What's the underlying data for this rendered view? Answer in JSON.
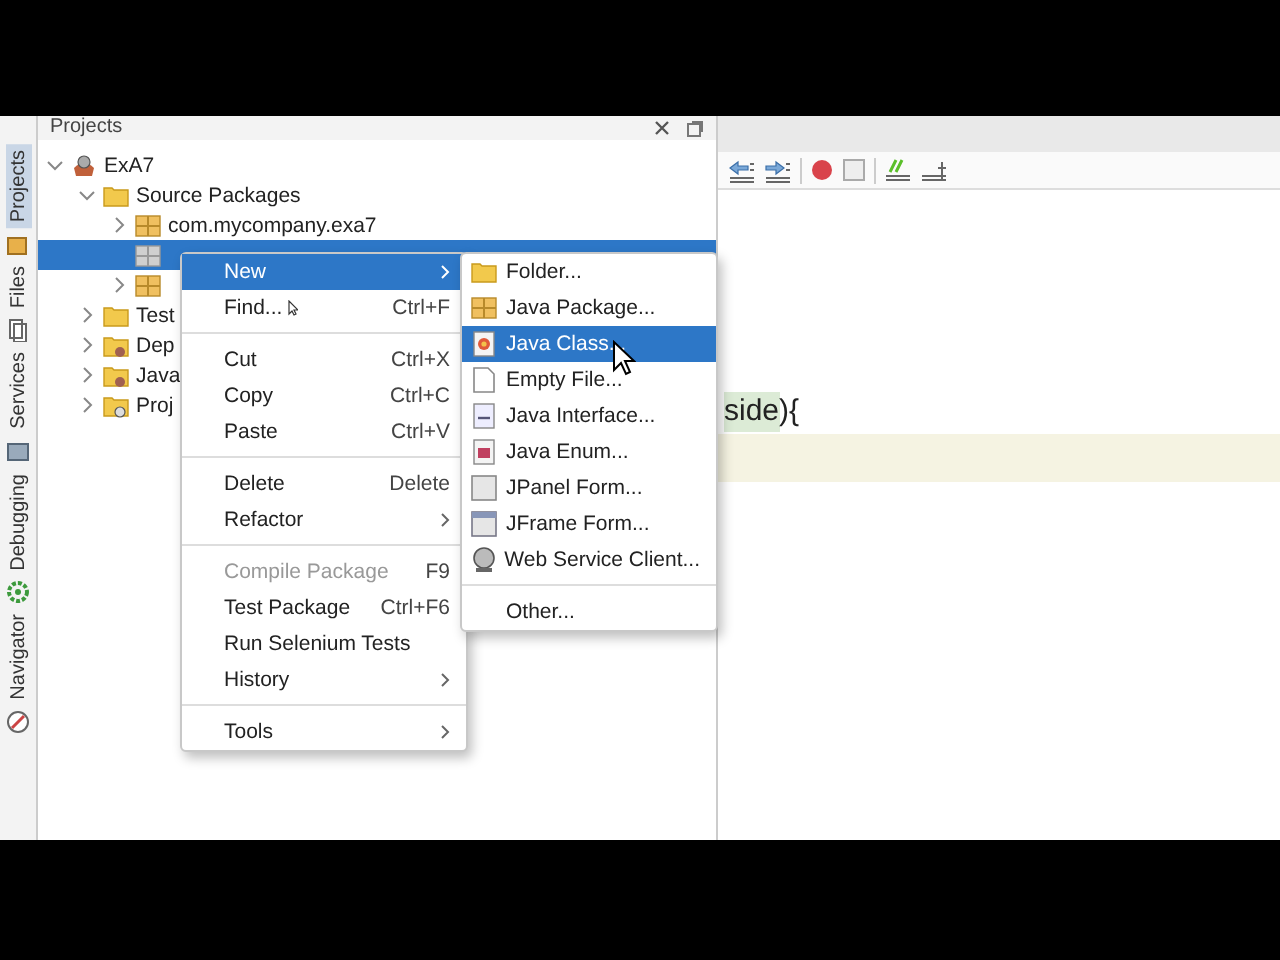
{
  "sidebar_tabs": [
    {
      "label": "Projects",
      "selected": true
    },
    {
      "label": "Files",
      "selected": false
    },
    {
      "label": "Services",
      "selected": false
    },
    {
      "label": "Debugging",
      "selected": false
    },
    {
      "label": "Navigator",
      "selected": false
    }
  ],
  "panel": {
    "title": "Projects"
  },
  "tree": [
    {
      "label": "ExA7",
      "kind": "project",
      "expanded": true,
      "selected": false,
      "children": [
        {
          "label": "Source Packages",
          "kind": "folder",
          "expanded": true,
          "selected": false,
          "children": [
            {
              "label": "com.mycompany.exa7",
              "kind": "package",
              "expanded": false,
              "selected": false
            },
            {
              "kind": "empty-package",
              "selected": true
            },
            {
              "kind": "package",
              "expanded": false,
              "selected": false
            }
          ]
        },
        {
          "label": "Test",
          "kind": "folder",
          "expanded": false,
          "selected": false
        },
        {
          "label": "Dep",
          "kind": "lib-folder",
          "expanded": false,
          "selected": false
        },
        {
          "label": "Java",
          "kind": "lib-folder",
          "expanded": false,
          "selected": false
        },
        {
          "label": "Proj",
          "kind": "config-folder",
          "expanded": false,
          "selected": false
        }
      ]
    }
  ],
  "context_menu": [
    {
      "kind": "item",
      "label": "New",
      "submenu": true,
      "selected": true,
      "disabled": false
    },
    {
      "kind": "item",
      "label": "Find...",
      "shortcut": "Ctrl+F",
      "submenu": false,
      "selected": false,
      "disabled": false
    },
    {
      "kind": "separator"
    },
    {
      "kind": "item",
      "label": "Cut",
      "shortcut": "Ctrl+X",
      "submenu": false,
      "selected": false,
      "disabled": false
    },
    {
      "kind": "item",
      "label": "Copy",
      "shortcut": "Ctrl+C",
      "submenu": false,
      "selected": false,
      "disabled": false
    },
    {
      "kind": "item",
      "label": "Paste",
      "shortcut": "Ctrl+V",
      "submenu": false,
      "selected": false,
      "disabled": false
    },
    {
      "kind": "separator"
    },
    {
      "kind": "item",
      "label": "Delete",
      "shortcut": "Delete",
      "submenu": false,
      "selected": false,
      "disabled": false
    },
    {
      "kind": "item",
      "label": "Refactor",
      "submenu": true,
      "selected": false,
      "disabled": false
    },
    {
      "kind": "separator"
    },
    {
      "kind": "item",
      "label": "Compile Package",
      "shortcut": "F9",
      "submenu": false,
      "selected": false,
      "disabled": true
    },
    {
      "kind": "item",
      "label": "Test Package",
      "shortcut": "Ctrl+F6",
      "submenu": false,
      "selected": false,
      "disabled": false
    },
    {
      "kind": "item",
      "label": "Run Selenium Tests",
      "submenu": false,
      "selected": false,
      "disabled": false
    },
    {
      "kind": "item",
      "label": "History",
      "submenu": true,
      "selected": false,
      "disabled": false
    },
    {
      "kind": "separator"
    },
    {
      "kind": "item",
      "label": "Tools",
      "submenu": true,
      "selected": false,
      "disabled": false
    }
  ],
  "new_submenu": [
    {
      "kind": "folder",
      "label": "Folder...",
      "selected": false
    },
    {
      "kind": "package",
      "label": "Java Package...",
      "selected": false
    },
    {
      "kind": "class",
      "label": "Java Class...",
      "selected": true
    },
    {
      "kind": "file",
      "label": "Empty File...",
      "selected": false
    },
    {
      "kind": "interface",
      "label": "Java Interface...",
      "selected": false
    },
    {
      "kind": "enum",
      "label": "Java Enum...",
      "selected": false
    },
    {
      "kind": "panel",
      "label": "JPanel Form...",
      "selected": false
    },
    {
      "kind": "frame",
      "label": "JFrame Form...",
      "selected": false
    },
    {
      "kind": "globe",
      "label": "Web Service Client...",
      "selected": false
    },
    {
      "kind": "separator"
    },
    {
      "kind": "plain",
      "label": "Other...",
      "selected": false
    }
  ],
  "editor": {
    "lines": [
      {
        "current": false,
        "tokens": [
          {
            "text": "side",
            "highlighted": true
          },
          {
            "text": "){",
            "highlighted": false
          }
        ]
      },
      {
        "current": true
      }
    ]
  }
}
